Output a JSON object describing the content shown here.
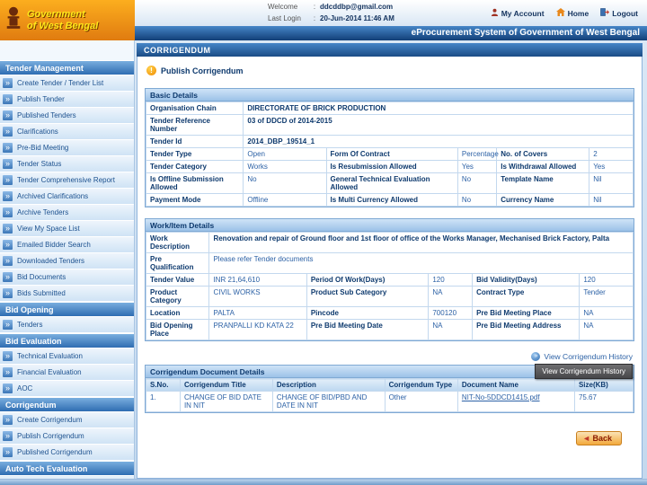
{
  "header": {
    "brand": {
      "line1": "Government",
      "line2": "of West Bengal"
    },
    "login": {
      "welcome_label": "Welcome",
      "last_login_label": "Last Login",
      "sep": ":",
      "email": "ddcddbp@gmail.com",
      "datetime": "20-Jun-2014 11:46 AM"
    },
    "nav": {
      "my_account": "My Account",
      "home": "Home",
      "logout": "Logout"
    },
    "app_title": "eProcurement System of Government of West Bengal"
  },
  "sidebar": {
    "sections": [
      {
        "title": "Tender Management",
        "items": [
          "Create Tender / Tender List",
          "Publish Tender",
          "Published Tenders",
          "Clarifications",
          "Pre-Bid Meeting",
          "Tender Status",
          "Tender Comprehensive Report",
          "Archived Clarifications",
          "Archive Tenders",
          "View My Space List",
          "Emailed Bidder Search",
          "Downloaded Tenders",
          "Bid Documents",
          "Bids Submitted"
        ]
      },
      {
        "title": "Bid Opening",
        "items": [
          "Tenders"
        ]
      },
      {
        "title": "Bid Evaluation",
        "items": [
          "Technical Evaluation",
          "Financial Evaluation",
          "AOC"
        ]
      },
      {
        "title": "Corrigendum",
        "items": [
          "Create Corrigendum",
          "Publish Corrigendum",
          "Published Corrigendum"
        ]
      },
      {
        "title": "Auto Tech Evaluation",
        "items": []
      }
    ]
  },
  "main": {
    "page_title": "CORRIGENDUM",
    "publish_heading": "Publish Corrigendum",
    "basic": {
      "title": "Basic Details",
      "span_rows": [
        {
          "label": "Organisation Chain",
          "value": "DIRECTORATE OF BRICK PRODUCTION"
        },
        {
          "label": "Tender Reference Number",
          "value": "03 of DDCD of 2014-2015"
        },
        {
          "label": "Tender Id",
          "value": "2014_DBP_19514_1"
        }
      ],
      "grid_rows": [
        [
          "Tender Type",
          "Open",
          "Form Of Contract",
          "Percentage",
          "No. of Covers",
          "2"
        ],
        [
          "Tender Category",
          "Works",
          "Is Resubmission Allowed",
          "Yes",
          "Is Withdrawal Allowed",
          "Yes"
        ],
        [
          "Is Offline Submission Allowed",
          "No",
          "General Technical Evaluation Allowed",
          "No",
          "Template Name",
          "Nil"
        ],
        [
          "Payment Mode",
          "Offline",
          "Is Multi Currency Allowed",
          "No",
          "Currency Name",
          "Nil"
        ]
      ]
    },
    "work": {
      "title": "Work/Item Details",
      "span_rows": [
        {
          "label": "Work Description",
          "value": "Renovation and repair of Ground floor and 1st floor of office of the Works Manager, Mechanised Brick Factory, Palta"
        },
        {
          "label": "Pre Qualification",
          "value": "Please refer Tender documents"
        }
      ],
      "grid_rows": [
        [
          "Tender Value",
          "INR 21,64,610",
          "Period Of Work(Days)",
          "120",
          "Bid Validity(Days)",
          "120"
        ],
        [
          "Product Category",
          "CIVIL WORKS",
          "Product Sub Category",
          "NA",
          "Contract Type",
          "Tender"
        ],
        [
          "Location",
          "PALTA",
          "Pincode",
          "700120",
          "Pre Bid Meeting Place",
          "NA"
        ],
        [
          "Bid Opening Place",
          "PRANPALLI KD KATA 22",
          "Pre Bid Meeting Date",
          "NA",
          "Pre Bid Meeting Address",
          "NA"
        ]
      ]
    },
    "history_link": "View Corrigendum History",
    "tooltip": "View Corrigendum History",
    "doc": {
      "title": "Corrigendum Document Details",
      "headers": [
        "S.No.",
        "Corrigendum Title",
        "Description",
        "Corrigendum Type",
        "Document Name",
        "Size(KB)"
      ],
      "rows": [
        [
          "1.",
          "CHANGE OF BID DATE IN NIT",
          "CHANGE OF BID/PBD AND DATE IN NIT",
          "Other",
          "NIT-No-5DDCD1415.pdf",
          "75.67"
        ]
      ]
    },
    "back_label": "Back"
  }
}
